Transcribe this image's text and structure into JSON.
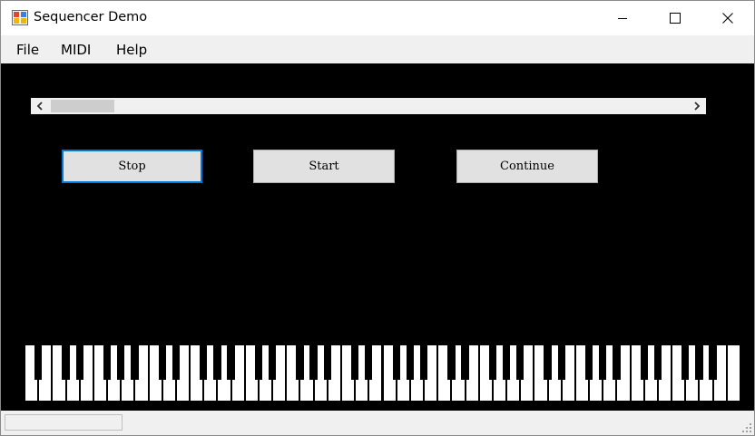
{
  "window": {
    "title": "Sequencer Demo",
    "icon": "app-window-icon",
    "controls": {
      "minimize": "minimize-icon",
      "maximize": "maximize-icon",
      "close": "close-icon"
    }
  },
  "menu": {
    "items": [
      {
        "label": "File"
      },
      {
        "label": "MIDI"
      },
      {
        "label": "Help"
      }
    ]
  },
  "scrollbar": {
    "left_arrow": "<",
    "right_arrow": ">",
    "position": 0.0
  },
  "buttons": {
    "stop": "Stop",
    "start": "Start",
    "continue": "Continue",
    "focused": "Stop"
  },
  "piano": {
    "white_key_count": 52,
    "keys": "88-key piano keyboard"
  },
  "statusbar": {
    "panel_text": ""
  },
  "colors": {
    "client_background": "#000000",
    "focus_border": "#0078d7",
    "button_face": "#e1e1e1",
    "chrome": "#f0f0f0"
  }
}
